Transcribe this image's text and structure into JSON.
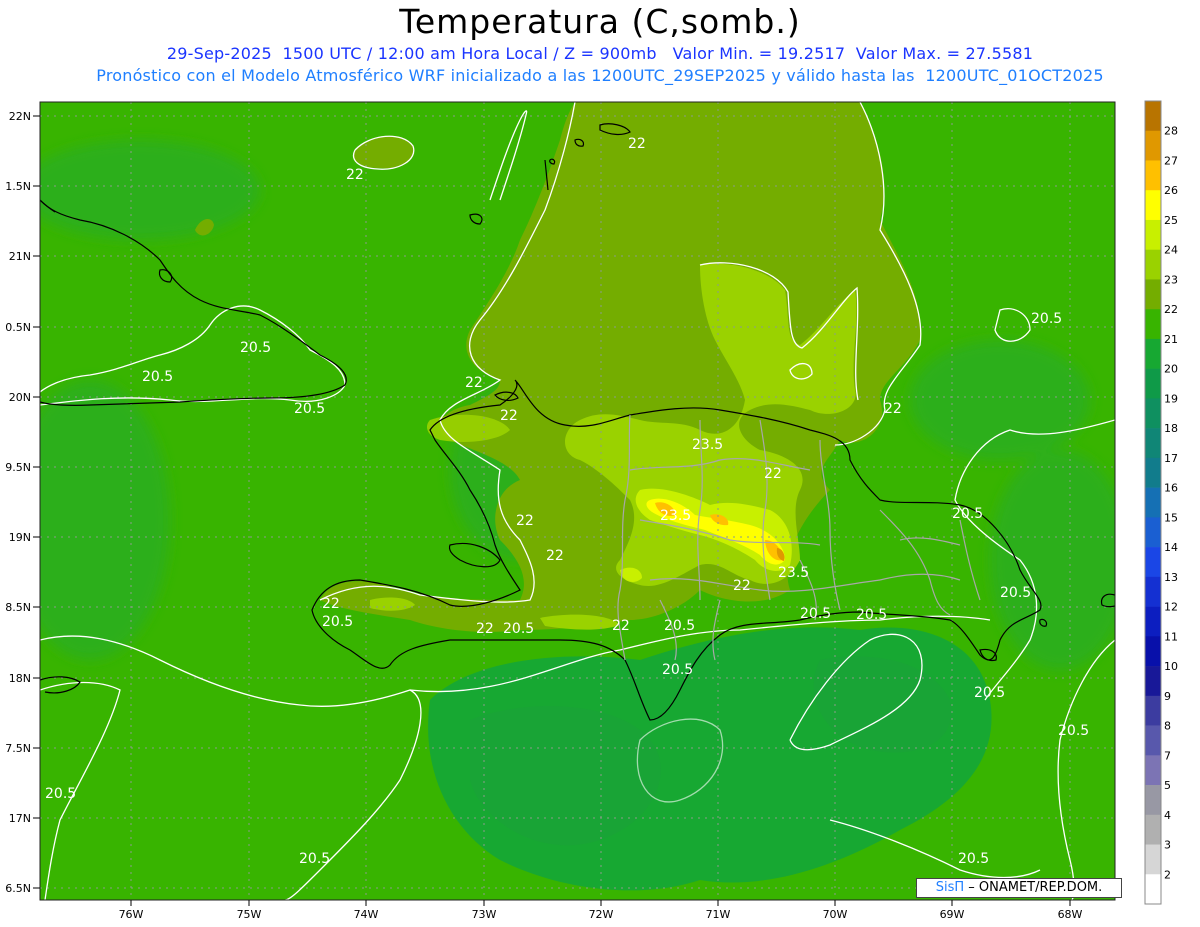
{
  "title": "Temperatura (C,somb.)",
  "subtitle1": "29-Sep-2025  1500 UTC / 12:00 am Hora Local / Z = 900mb   Valor Min. = 19.2517  Valor Max. = 27.5581",
  "subtitle2": "Pronóstico con el Modelo Atmosférico WRF inicializado a las 1200UTC_29SEP2025 y válido hasta las  1200UTC_01OCT2025",
  "credit": {
    "brand": "SisΠ",
    "org": " – ONAMET/REP.DOM."
  },
  "axes": {
    "lon_labels": [
      "76W",
      "75W",
      "74W",
      "73W",
      "72W",
      "71W",
      "70W",
      "69W",
      "68W"
    ],
    "lat_labels": [
      "22N",
      "1.5N",
      "21N",
      "0.5N",
      "20N",
      "9.5N",
      "19N",
      "8.5N",
      "18N",
      "7.5N",
      "17N",
      "6.5N"
    ]
  },
  "colorbar": {
    "labels": [
      "28",
      "27",
      "26",
      "25",
      "24",
      "23",
      "22",
      "21",
      "20",
      "19",
      "18",
      "17",
      "16",
      "15",
      "14",
      "13",
      "12",
      "11",
      "10",
      "9",
      "8",
      "7",
      "5",
      "4",
      "3",
      "2"
    ],
    "colors": [
      "#b87400",
      "#e09800",
      "#ffc000",
      "#ffff00",
      "#c8f000",
      "#9ad200",
      "#74ad00",
      "#38b400",
      "#17a832",
      "#0f9a48",
      "#0f9060",
      "#108676",
      "#117c8c",
      "#1570b4",
      "#1a5fd2",
      "#1a46e6",
      "#1430d2",
      "#0c1ec0",
      "#0810aa",
      "#181898",
      "#3c3ca0",
      "#5858ac",
      "#7c74b4",
      "#9898a4",
      "#b0b0b0",
      "#d6d6d6",
      "#ffffff"
    ]
  },
  "contour_labels": [
    {
      "text": "22",
      "pos": "near Andros/Exuma"
    },
    {
      "text": "22",
      "pos": "N of Haiti NW"
    },
    {
      "text": "22",
      "pos": "Cibao"
    },
    {
      "text": "22",
      "pos": "N Haiti"
    },
    {
      "text": "22",
      "pos": "Turks"
    },
    {
      "text": "22",
      "pos": "Gonave"
    },
    {
      "text": "22",
      "pos": "Central Haiti"
    },
    {
      "text": "22",
      "pos": "SW peninsula"
    },
    {
      "text": "22",
      "pos": "S coast Haiti"
    },
    {
      "text": "22",
      "pos": "Barahona"
    },
    {
      "text": "22",
      "pos": "Cordillera Central"
    },
    {
      "text": "22",
      "pos": "N Atlantic"
    },
    {
      "text": "20.5",
      "pos": "E Cuba"
    },
    {
      "text": "20.5",
      "pos": "Windward Passage"
    },
    {
      "text": "20.5",
      "pos": "Cuba coast"
    },
    {
      "text": "20.5",
      "pos": "Tiburon"
    },
    {
      "text": "20.5",
      "pos": "S coast Haiti"
    },
    {
      "text": "20.5",
      "pos": "Baoruco"
    },
    {
      "text": "20.5",
      "pos": "Pedernales"
    },
    {
      "text": "20.5",
      "pos": "Santo Domingo W"
    },
    {
      "text": "20.5",
      "pos": "Santo Domingo E"
    },
    {
      "text": "20.5",
      "pos": "Samana"
    },
    {
      "text": "20.5",
      "pos": "Mona E"
    },
    {
      "text": "20.5",
      "pos": "Puerto Rico"
    },
    {
      "text": "20.5",
      "pos": "Atlantic E"
    },
    {
      "text": "20.5",
      "pos": "Caribbean E"
    },
    {
      "text": "20.5",
      "pos": "Caribbean S"
    },
    {
      "text": "20.5",
      "pos": "Caribbean SE"
    },
    {
      "text": "20.5",
      "pos": "Jamaica E"
    },
    {
      "text": "23.5",
      "pos": "Central DR N"
    },
    {
      "text": "23.5",
      "pos": "Cordillera"
    },
    {
      "text": "23.5",
      "pos": "Cordillera E"
    }
  ]
}
